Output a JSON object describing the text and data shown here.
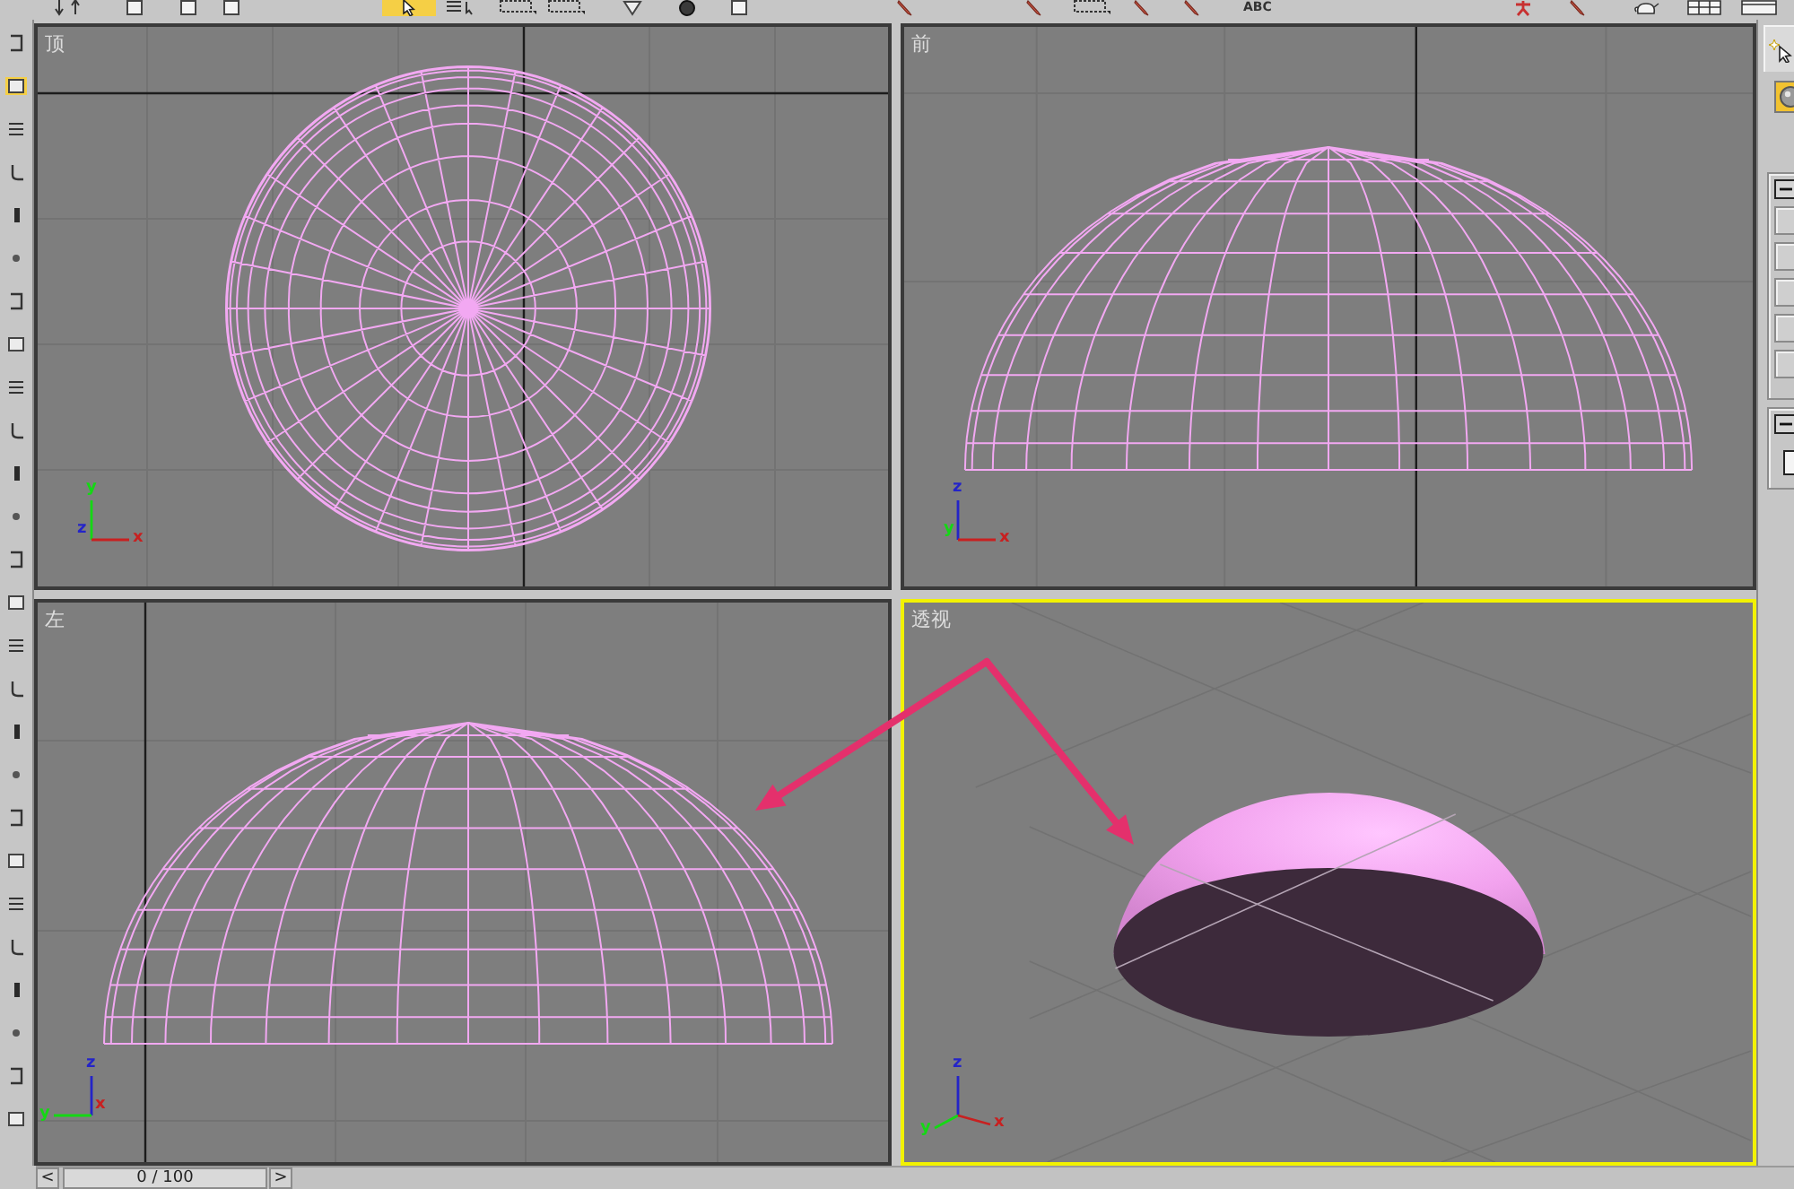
{
  "toolbar": {
    "tools": [
      {
        "kind": "icon",
        "selected": false
      },
      {
        "kind": "icon",
        "selected": false
      },
      {
        "kind": "icon",
        "selected": false
      },
      {
        "kind": "icon",
        "selected": false
      },
      {
        "kind": "icon",
        "selected": true
      },
      {
        "kind": "icon",
        "selected": false
      },
      {
        "kind": "icon",
        "selected": false
      },
      {
        "kind": "icon",
        "selected": false
      },
      {
        "kind": "icon",
        "selected": false
      },
      {
        "kind": "icon",
        "selected": false
      },
      {
        "kind": "icon",
        "selected": false
      },
      {
        "kind": "icon",
        "selected": false
      },
      {
        "kind": "icon",
        "selected": false
      },
      {
        "kind": "icon",
        "selected": false
      },
      {
        "kind": "icon",
        "selected": false
      },
      {
        "kind": "icon",
        "selected": false
      },
      {
        "kind": "text",
        "label": "ABC",
        "selected": false
      },
      {
        "kind": "icon",
        "selected": false
      },
      {
        "kind": "icon",
        "selected": false
      },
      {
        "kind": "icon",
        "selected": false
      },
      {
        "kind": "icon",
        "selected": false
      },
      {
        "kind": "icon",
        "selected": false
      }
    ]
  },
  "left_toolbar": {
    "tools": [
      {
        "selected": false
      },
      {
        "selected": true
      },
      {
        "selected": false
      },
      {
        "selected": false
      },
      {
        "selected": false
      },
      {
        "selected": false
      },
      {
        "selected": false
      },
      {
        "selected": false
      },
      {
        "selected": false
      },
      {
        "selected": false
      },
      {
        "selected": false
      },
      {
        "selected": false
      },
      {
        "selected": false
      },
      {
        "selected": false
      },
      {
        "selected": false
      },
      {
        "selected": false
      },
      {
        "selected": false
      },
      {
        "selected": false
      },
      {
        "selected": false
      },
      {
        "selected": false
      },
      {
        "selected": false
      },
      {
        "selected": false
      },
      {
        "selected": false
      },
      {
        "selected": false
      },
      {
        "selected": false
      },
      {
        "selected": false
      }
    ]
  },
  "viewports": [
    {
      "label": "顶",
      "kind": "top",
      "active": false,
      "axes": [
        {
          "letter": "y",
          "color": "#14d814",
          "kind": "up"
        },
        {
          "letter": "z",
          "color": "#2424c8",
          "kind": "origin"
        },
        {
          "letter": "x",
          "color": "#c82020",
          "kind": "right"
        }
      ]
    },
    {
      "label": "前",
      "kind": "front",
      "active": false,
      "axes": [
        {
          "letter": "z",
          "color": "#2424c8",
          "kind": "up"
        },
        {
          "letter": "y",
          "color": "#14d814",
          "kind": "origin"
        },
        {
          "letter": "x",
          "color": "#c82020",
          "kind": "right"
        }
      ]
    },
    {
      "label": "左",
      "kind": "left",
      "active": false,
      "axes": [
        {
          "letter": "z",
          "color": "#2424c8",
          "kind": "up"
        },
        {
          "letter": "y",
          "color": "#14d814",
          "kind": "left"
        },
        {
          "letter": "x",
          "color": "#c82020",
          "kind": "origin"
        }
      ]
    },
    {
      "label": "透视",
      "kind": "perspective",
      "active": true,
      "axes": [
        {
          "letter": "z",
          "color": "#2424c8",
          "kind": "up"
        },
        {
          "letter": "y",
          "color": "#14d814",
          "kind": "down-left"
        },
        {
          "letter": "x",
          "color": "#c82020",
          "kind": "down-right"
        }
      ]
    }
  ],
  "command_panel": {
    "tabs": [
      {
        "selected": true
      }
    ],
    "object_types": [
      {
        "selected": true
      }
    ],
    "rollouts": [
      {
        "kind": "buttons",
        "expanded": true
      },
      {
        "kind": "checkbox",
        "expanded": true,
        "checked": false
      }
    ]
  },
  "timeline": {
    "prev": "<",
    "position": "0 / 100",
    "next": ">",
    "level": 0
  }
}
